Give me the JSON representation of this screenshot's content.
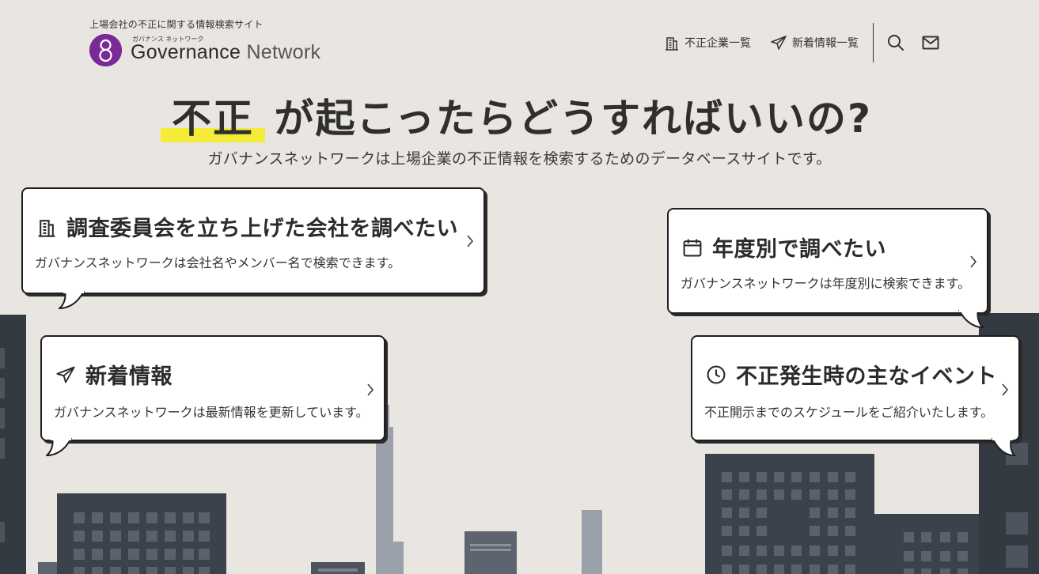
{
  "header": {
    "tagline": "上場会社の不正に関する情報検索サイト",
    "logo_kana": "ガバナンス ネットワーク",
    "logo_word1": "Governance",
    "logo_word2": "Network",
    "nav": {
      "companies_label": "不正企業一覧",
      "news_label": "新着情報一覧"
    },
    "icons": {
      "companies": "building-icon",
      "news": "paper-plane-icon",
      "search": "search-icon",
      "mail": "mail-icon"
    }
  },
  "hero": {
    "title_highlight": "不正",
    "title_rest": "が起こったらどうすればいいの?",
    "subtitle": "ガバナンスネットワークは上場企業の不正情報を検索するためのデータベースサイトです。"
  },
  "cards": [
    {
      "title": "調査委員会を立ち上げた会社を調べたい",
      "desc": "ガバナンスネットワークは会社名やメンバー名で検索できます。",
      "icon": "building-icon"
    },
    {
      "title": "年度別で調べたい",
      "desc": "ガバナンスネットワークは年度別に検索できます。",
      "icon": "calendar-icon"
    },
    {
      "title": "新着情報",
      "desc": "ガバナンスネットワークは最新情報を更新しています。",
      "icon": "paper-plane-icon"
    },
    {
      "title": "不正発生時の主なイベント",
      "desc": "不正開示までのスケジュールをご紹介いたします。",
      "icon": "clock-icon"
    }
  ],
  "colors": {
    "background": "#e9e5e0",
    "highlight": "#f5ec3a",
    "logo_purple": "#7a2a96",
    "building_dark": "#3a3f47",
    "building_light": "#9aa1aa"
  }
}
